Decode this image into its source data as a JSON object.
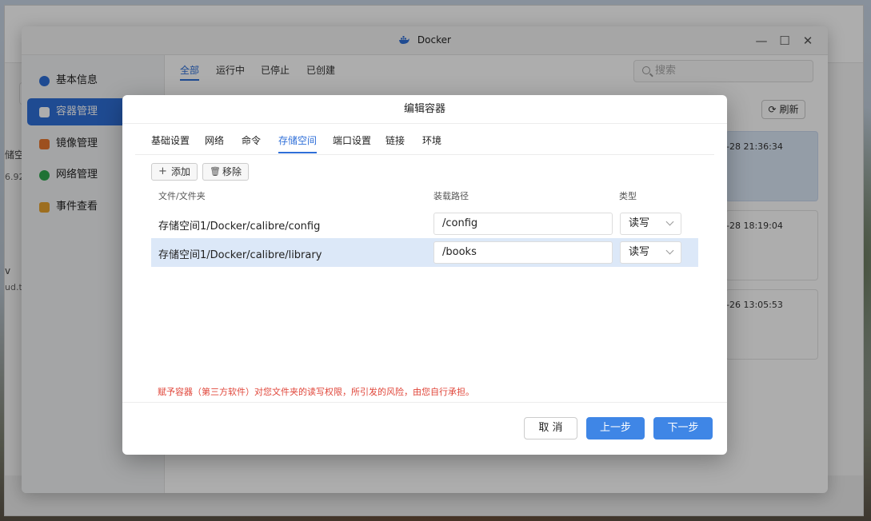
{
  "window": {
    "title": "Docker"
  },
  "sidebar": {
    "items": [
      {
        "label": "基本信息",
        "icon": "docker-whale-icon",
        "color": "#2f6fd8"
      },
      {
        "label": "容器管理",
        "icon": "cube-icon",
        "color": "#ffffff",
        "active": true
      },
      {
        "label": "镜像管理",
        "icon": "image-icon",
        "color": "#e8772e"
      },
      {
        "label": "网络管理",
        "icon": "globe-icon",
        "color": "#2fa84f"
      },
      {
        "label": "事件查看",
        "icon": "calendar-icon",
        "color": "#e8a22e"
      }
    ]
  },
  "main": {
    "tabs": [
      {
        "label": "全部",
        "active": true
      },
      {
        "label": "运行中"
      },
      {
        "label": "已停止"
      },
      {
        "label": "已创建"
      }
    ],
    "search_placeholder": "搜索",
    "refresh_label": "刷新",
    "cards": [
      {
        "time": "-28 21:36:34"
      },
      {
        "time": "-28 18:19:04"
      },
      {
        "time": "-26 13:05:53"
      }
    ]
  },
  "background_fragments": {
    "storage_text": "储空",
    "number_text": "6.92",
    "v_text": "v",
    "url_text": "ud.to"
  },
  "modal": {
    "title": "编辑容器",
    "tabs": [
      {
        "label": "基础设置"
      },
      {
        "label": "网络"
      },
      {
        "label": "命令"
      },
      {
        "label": "存储空间",
        "active": true
      },
      {
        "label": "端口设置"
      },
      {
        "label": "链接"
      },
      {
        "label": "环境"
      }
    ],
    "add_label": "添加",
    "remove_label": "移除",
    "columns": {
      "folder": "文件/文件夹",
      "mount": "装载路径",
      "type": "类型"
    },
    "rows": [
      {
        "path": "存储空间1/Docker/calibre/config",
        "mount": "/config",
        "type": "读写",
        "selected": false
      },
      {
        "path": "存储空间1/Docker/calibre/library",
        "mount": "/books",
        "type": "读写",
        "selected": true
      }
    ],
    "warning": "赋予容器（第三方软件）对您文件夹的读写权限，所引发的风险，由您自行承担。",
    "buttons": {
      "cancel": "取 消",
      "prev": "上一步",
      "next": "下一步"
    }
  },
  "colors": {
    "accent": "#2f6fd8",
    "primary_button": "#3f86e6",
    "warning": "#e0463a",
    "selected_row": "#dce8f8"
  }
}
